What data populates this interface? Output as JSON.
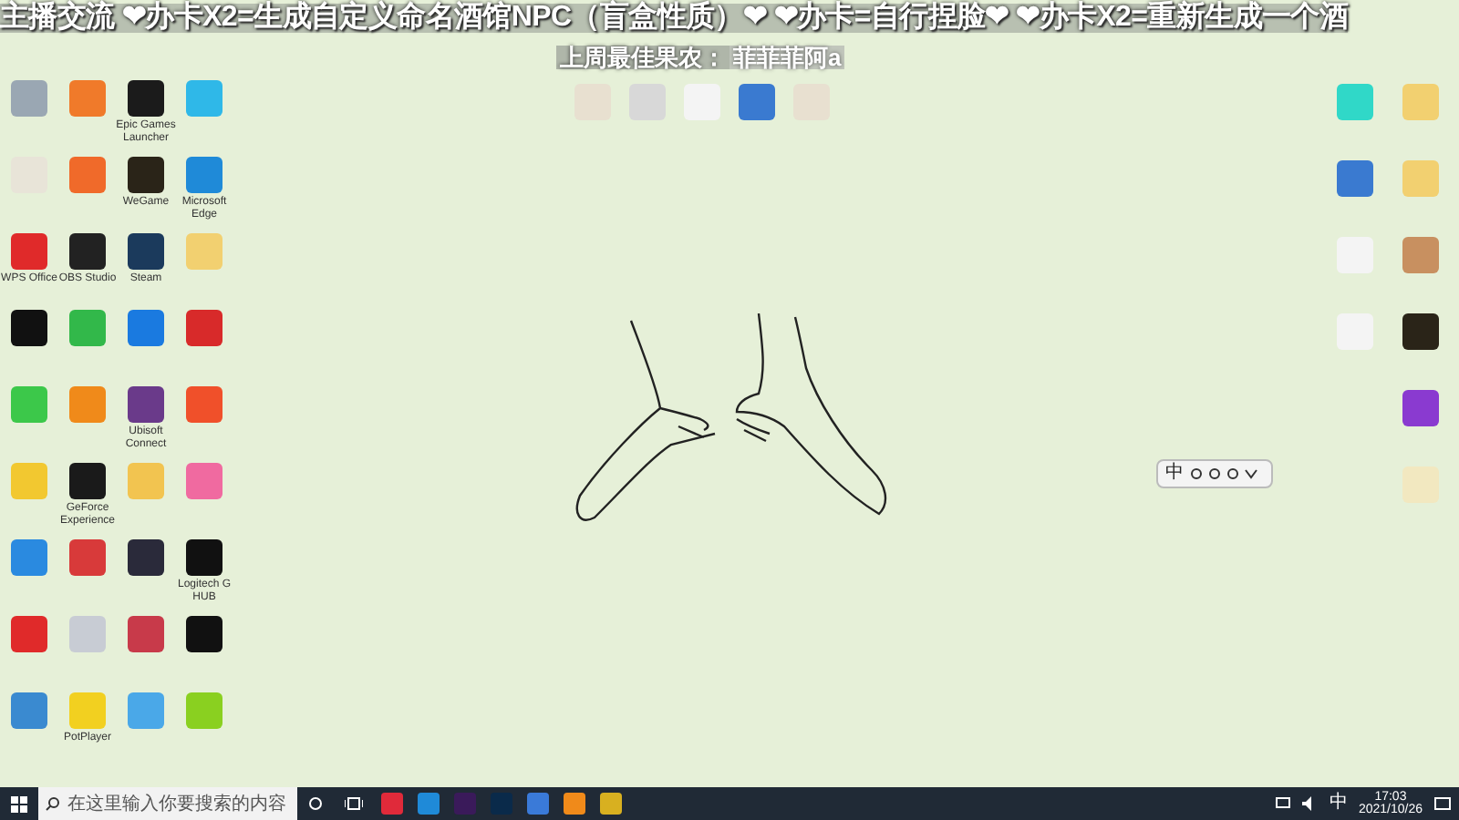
{
  "overlay": {
    "marquee": "主播交流 ❤办卡X2=生成自定义命名酒馆NPC（盲盒性质）❤ ❤办卡=自行捏脸❤ ❤办卡X2=重新生成一个酒",
    "best_label": "上周最佳果农：",
    "best_name": "菲菲菲阿a"
  },
  "desktop": {
    "left_icons": [
      {
        "color": "#9aa7b3"
      },
      {
        "color": "#f07a2a"
      },
      {
        "color": "#1b1b1b",
        "label": "Epic Games Launcher"
      },
      {
        "color": "#2fb8e8"
      },
      {
        "color": "#e8e4d8"
      },
      {
        "color": "#f06a2a"
      },
      {
        "color": "#2a2418",
        "label": "WeGame"
      },
      {
        "color": "#1f8ad8",
        "label": "Microsoft Edge"
      },
      {
        "color": "#e02a2a",
        "label": "WPS Office"
      },
      {
        "color": "#222222",
        "label": "OBS Studio"
      },
      {
        "color": "#1b3a5c",
        "label": "Steam"
      },
      {
        "color": "#f2d070"
      },
      {
        "color": "#111111"
      },
      {
        "color": "#32b84a"
      },
      {
        "color": "#1a7ae0"
      },
      {
        "color": "#d82a2a"
      },
      {
        "color": "#3cc84a"
      },
      {
        "color": "#f08a1a"
      },
      {
        "color": "#6a3a8a",
        "label": "Ubisoft Connect"
      },
      {
        "color": "#f0502a"
      },
      {
        "color": "#f2c830"
      },
      {
        "color": "#1a1a1a",
        "label": "GeForce Experience"
      },
      {
        "color": "#f2c450"
      },
      {
        "color": "#f06aa0"
      },
      {
        "color": "#2a8ae0"
      },
      {
        "color": "#d83a3a"
      },
      {
        "color": "#2a2a3a"
      },
      {
        "color": "#111111",
        "label": "Logitech G HUB"
      },
      {
        "color": "#e02a2a"
      },
      {
        "color": "#c8ccd4"
      },
      {
        "color": "#c83a4a"
      },
      {
        "color": "#111111"
      },
      {
        "color": "#3a8ad0"
      },
      {
        "color": "#f2d020",
        "label": "PotPlayer"
      },
      {
        "color": "#4aa8e8"
      },
      {
        "color": "#8ad020"
      }
    ],
    "top_icons": [
      {
        "color": "#e8e0d0"
      },
      {
        "color": "#d8d8d8"
      },
      {
        "color": "#f4f4f4"
      },
      {
        "color": "#3a7ad0"
      },
      {
        "color": "#e8e0d0"
      }
    ],
    "right_icons": [
      {
        "color": "#30d8c8"
      },
      {
        "color": "#f2d070"
      },
      {
        "color": "#3a7ad0"
      },
      {
        "color": "#f2d070"
      },
      {
        "color": "#f4f4f4"
      },
      {
        "color": "#c89060"
      },
      {
        "color": "#f4f4f4"
      },
      {
        "color": "#2a2418"
      },
      {
        "color": "#8a3ad0"
      },
      {
        "color": "#f2e8c0"
      }
    ]
  },
  "ime_toolbar": {
    "mode": "中"
  },
  "taskbar": {
    "search": {
      "placeholder": "在这里输入你要搜索的内容"
    },
    "pinned": [
      {
        "color": "#e02a3a"
      },
      {
        "color": "#1f8ad8"
      },
      {
        "color": "#3a1a5a"
      },
      {
        "color": "#0a2a4a"
      },
      {
        "color": "#3a7ad8"
      },
      {
        "color": "#f08a1a"
      },
      {
        "color": "#d8b020"
      }
    ],
    "ime": "中",
    "time": "17:03",
    "date": "2021/10/26"
  }
}
